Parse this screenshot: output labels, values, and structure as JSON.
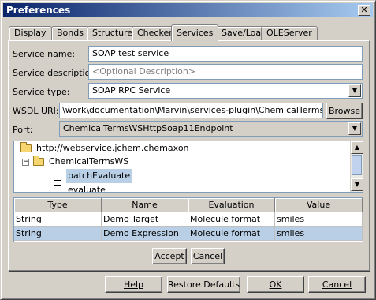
{
  "window": {
    "title": "Preferences",
    "close_glyph": "✕"
  },
  "tabs": [
    {
      "label": "Display"
    },
    {
      "label": "Bonds"
    },
    {
      "label": "Structure"
    },
    {
      "label": "Checkers"
    },
    {
      "label": "Services",
      "active": true
    },
    {
      "label": "Save/Load"
    },
    {
      "label": "OLEServer"
    }
  ],
  "form": {
    "service_name_label": "Service name:",
    "service_name_value": "SOAP test service",
    "service_description_label": "Service description:",
    "service_description_placeholder": "<Optional Description>",
    "service_type_label": "Service type:",
    "service_type_value": "SOAP RPC Service",
    "wsdl_uri_label": "WSDL URI:",
    "wsdl_uri_value": "\\work\\documentation\\Marvin\\services-plugin\\ChemicalTermsWS.wsdl",
    "browse_label": "Browse",
    "port_label": "Port:",
    "port_value": "ChemicalTermsWSHttpSoap11Endpoint"
  },
  "tree": {
    "root": "http://webservice.jchem.chemaxon",
    "service": "ChemicalTermsWS",
    "methods": [
      "batchEvaluate",
      "evaluate"
    ],
    "selected_method": "batchEvaluate"
  },
  "table": {
    "columns": [
      "Type",
      "Name",
      "Evaluation",
      "Value"
    ],
    "rows": [
      {
        "type": "String",
        "name": "Demo Target",
        "evaluation": "Molecule format",
        "value": "smiles"
      },
      {
        "type": "String",
        "name": "Demo Expression",
        "evaluation": "Molecule format",
        "value": "smiles",
        "selected": true
      }
    ]
  },
  "panel_buttons": {
    "accept": "Accept",
    "cancel": "Cancel"
  },
  "dialog_buttons": {
    "help": "Help",
    "restore": "Restore Defaults",
    "ok": "OK",
    "cancel": "Cancel"
  },
  "colors": {
    "selection": "#b8cfe5",
    "title_gradient_start": "#0a246a",
    "title_gradient_end": "#a6caf0"
  }
}
